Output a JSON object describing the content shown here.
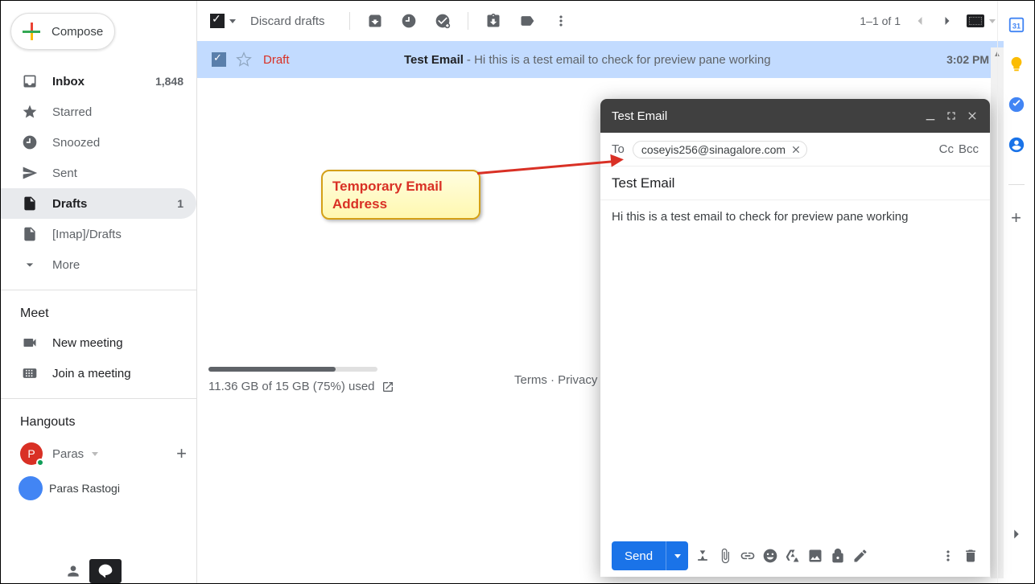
{
  "compose": {
    "label": "Compose"
  },
  "folders": {
    "inbox": {
      "label": "Inbox",
      "count": "1,848"
    },
    "starred": {
      "label": "Starred"
    },
    "snoozed": {
      "label": "Snoozed"
    },
    "sent": {
      "label": "Sent"
    },
    "drafts": {
      "label": "Drafts",
      "count": "1"
    },
    "imap": {
      "label": "[Imap]/Drafts"
    },
    "more": {
      "label": "More"
    }
  },
  "meet": {
    "title": "Meet",
    "new": "New meeting",
    "join": "Join a meeting"
  },
  "hangouts": {
    "title": "Hangouts",
    "user": "Paras",
    "initial": "P",
    "contact": "Paras Rastogi"
  },
  "toolbar": {
    "discard": "Discard drafts",
    "page_indicator": "1–1 of 1"
  },
  "message": {
    "label": "Draft",
    "subject": "Test Email",
    "snippet": " - Hi this is a test email to check for preview pane working",
    "time": "3:02 PM"
  },
  "footer": {
    "storage": "11.36 GB of 15 GB (75%) used",
    "links": "Terms · Privacy · Pr"
  },
  "composewin": {
    "title": "Test Email",
    "to_label": "To",
    "to_chip": "coseyis256@sinagalore.com",
    "cc": "Cc",
    "bcc": "Bcc",
    "subject": "Test Email",
    "body": "Hi this is a test email to check for preview pane working",
    "send": "Send"
  },
  "callout": {
    "line1": "Temporary Email",
    "line2": "Address"
  }
}
